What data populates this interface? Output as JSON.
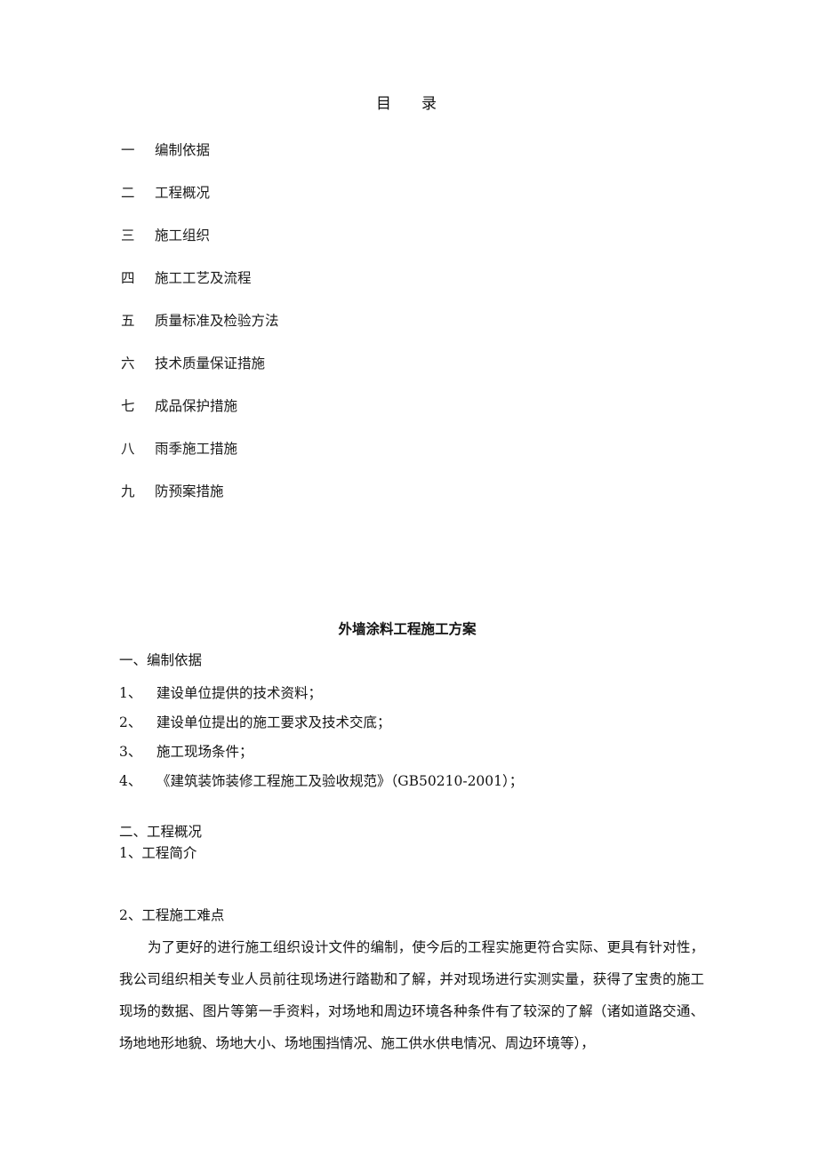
{
  "document": {
    "toc": {
      "heading_left": "目",
      "heading_right": "录",
      "items": [
        {
          "num": "一",
          "label": "编制依据"
        },
        {
          "num": "二",
          "label": "工程概况"
        },
        {
          "num": "三",
          "label": "施工组织"
        },
        {
          "num": "四",
          "label": "施工工艺及流程"
        },
        {
          "num": "五",
          "label": "质量标准及检验方法"
        },
        {
          "num": "六",
          "label": "技术质量保证措施"
        },
        {
          "num": "七",
          "label": "成品保护措施"
        },
        {
          "num": "八",
          "label": "雨季施工措施"
        },
        {
          "num": "九",
          "label": "防预案措施"
        }
      ]
    },
    "title": "外墙涂料工程施工方案",
    "section_one": {
      "heading": "一、编制依据",
      "items": [
        {
          "num": "1、",
          "text": "建设单位提供的技术资料；"
        },
        {
          "num": "2、",
          "text": "建设单位提出的施工要求及技术交底；"
        },
        {
          "num": "3、",
          "text": "施工现场条件；"
        },
        {
          "num": "4、",
          "text": "《建筑装饰装修工程施工及验收规范》（GB50210-2001）；"
        }
      ]
    },
    "section_two": {
      "heading": "二、工程概况",
      "sub_one": "1、工程简介",
      "sub_two": "2、工程施工难点",
      "paragraph": "为了更好的进行施工组织设计文件的编制，使今后的工程实施更符合实际、更具有针对性，我公司组织相关专业人员前往现场进行踏勘和了解，并对现场进行实测实量，获得了宝贵的施工现场的数据、图片等第一手资料，对场地和周边环境各种条件有了较深的了解（诸如道路交通、场地地形地貌、场地大小、场地围挡情况、施工供水供电情况、周边环境等），"
    }
  }
}
